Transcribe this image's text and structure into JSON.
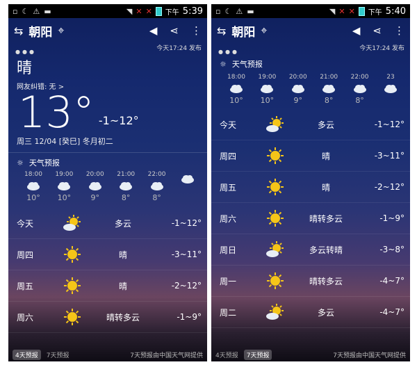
{
  "left": {
    "status_time": "5:39",
    "status_ampm": "下午",
    "city": "朝阳",
    "publish": "今天17:24 发布",
    "condition": "晴",
    "feedback": "网友纠错: 无 >",
    "big_temp": "13°",
    "range": "-1~12°",
    "date": "周三  12/04  [癸巳]  冬月初二",
    "section_title": "天气预报",
    "hourly": [
      {
        "time": "18:00",
        "temp": "10°"
      },
      {
        "time": "19:00",
        "temp": "10°"
      },
      {
        "time": "20:00",
        "temp": "9°"
      },
      {
        "time": "21:00",
        "temp": "8°"
      },
      {
        "time": "22:00",
        "temp": "8°"
      },
      {
        "time": "",
        "temp": ""
      }
    ],
    "daily": [
      {
        "day": "今天",
        "icon": "partly-cloudy",
        "cond": "多云",
        "temp": "-1~12°"
      },
      {
        "day": "周四",
        "icon": "sunny",
        "cond": "晴",
        "temp": "-3~11°"
      },
      {
        "day": "周五",
        "icon": "sunny",
        "cond": "晴",
        "temp": "-2~12°"
      },
      {
        "day": "周六",
        "icon": "sunny",
        "cond": "晴转多云",
        "temp": "-1~9°"
      }
    ],
    "footer": {
      "tab4": "4天预报",
      "tab7": "7天预报",
      "source": "7天预报由中国天气网提供"
    }
  },
  "right": {
    "status_time": "5:40",
    "status_ampm": "下午",
    "city": "朝阳",
    "publish": "今天17:24 发布",
    "section_title": "天气预报",
    "hourly": [
      {
        "time": "18:00",
        "temp": "10°"
      },
      {
        "time": "19:00",
        "temp": "10°"
      },
      {
        "time": "20:00",
        "temp": "9°"
      },
      {
        "time": "21:00",
        "temp": "8°"
      },
      {
        "time": "22:00",
        "temp": "8°"
      },
      {
        "time": "23",
        "temp": ""
      }
    ],
    "daily": [
      {
        "day": "今天",
        "icon": "partly-cloudy",
        "cond": "多云",
        "temp": "-1~12°"
      },
      {
        "day": "周四",
        "icon": "sunny",
        "cond": "晴",
        "temp": "-3~11°"
      },
      {
        "day": "周五",
        "icon": "sunny",
        "cond": "晴",
        "temp": "-2~12°"
      },
      {
        "day": "周六",
        "icon": "sunny",
        "cond": "晴转多云",
        "temp": "-1~9°"
      },
      {
        "day": "周日",
        "icon": "partly-cloudy",
        "cond": "多云转晴",
        "temp": "-3~8°"
      },
      {
        "day": "周一",
        "icon": "sunny",
        "cond": "晴转多云",
        "temp": "-4~7°"
      },
      {
        "day": "周二",
        "icon": "partly-cloudy",
        "cond": "多云",
        "temp": "-4~7°"
      }
    ],
    "footer": {
      "tab4": "4天预报",
      "tab7": "7天预报",
      "source": "7天预报由中国天气网提供"
    }
  },
  "colors": {
    "sun": "#f5c518",
    "cloud": "#e8eef5",
    "accent_alert": "#e03030"
  }
}
